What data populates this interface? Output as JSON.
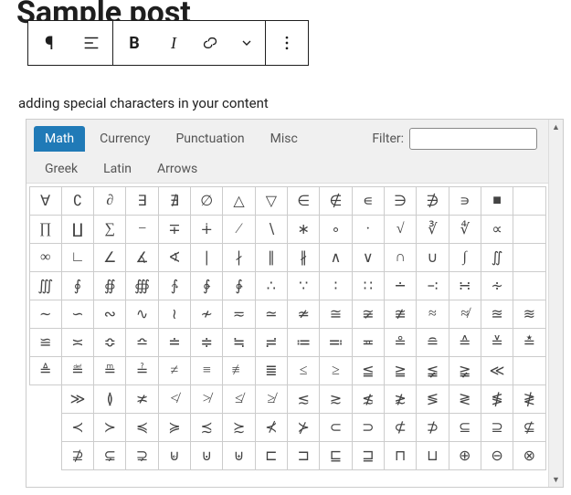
{
  "page_title": "Sample post",
  "content_line": "adding special characters in your content",
  "toolbar": {
    "pilcrow": "¶",
    "bold": "B",
    "italic": "I"
  },
  "charmap": {
    "filter_label": "Filter:",
    "tabs_row1": [
      {
        "label": "Math",
        "active": true
      },
      {
        "label": "Currency",
        "active": false
      },
      {
        "label": "Punctuation",
        "active": false
      },
      {
        "label": "Misc",
        "active": false
      }
    ],
    "tabs_row2": [
      {
        "label": "Greek",
        "active": false
      },
      {
        "label": "Latin",
        "active": false
      },
      {
        "label": "Arrows",
        "active": false
      }
    ],
    "grid": [
      [
        "∀",
        "∁",
        "∂",
        "∃",
        "∄",
        "∅",
        "△",
        "▽",
        "∈",
        "∉",
        "∊",
        "∋",
        "∌",
        "∍",
        "■",
        ""
      ],
      [
        "∏",
        "∐",
        "∑",
        "−",
        "∓",
        "∔",
        "∕",
        "∖",
        "∗",
        "∘",
        "∙",
        "√",
        "∛",
        "∜",
        "∝",
        ""
      ],
      [
        "∞",
        "∟",
        "∠",
        "∡",
        "∢",
        "∣",
        "∤",
        "∥",
        "∦",
        "∧",
        "∨",
        "∩",
        "∪",
        "∫",
        "∬",
        ""
      ],
      [
        "∭",
        "∮",
        "∯",
        "∰",
        "∱",
        "∲",
        "∳",
        "∴",
        "∵",
        "∶",
        "∷",
        "∸",
        "∹",
        "∺",
        "∻",
        ""
      ],
      [
        "∼",
        "∽",
        "∾",
        "∿",
        "≀",
        "≁",
        "≂",
        "≃",
        "≄",
        "≅",
        "≆",
        "≇",
        "≈",
        "≉",
        "≊",
        "≋",
        "≌"
      ],
      [
        "≍",
        "≎",
        "≏",
        "≐",
        "≑",
        "≒",
        "≓",
        "≔",
        "≕",
        "≖",
        "≗",
        "≘",
        "≙",
        "≚",
        "≛",
        "≜"
      ],
      [
        "≝",
        "≞",
        "≟",
        "≠",
        "≡",
        "≢",
        "≣",
        "≤",
        "≥",
        "≦",
        "≧",
        "≨",
        "≩",
        "≪",
        ""
      ],
      [
        "≫",
        "≬",
        "≭",
        "≮",
        "≯",
        "≰",
        "≱",
        "≲",
        "≳",
        "≴",
        "≵",
        "≶",
        "≷",
        "≸",
        "≹"
      ],
      [
        "≺",
        "≻",
        "≼",
        "≽",
        "≾",
        "≿",
        "⊀",
        "⊁",
        "⊂",
        "⊃",
        "⊄",
        "⊅",
        "⊆",
        "⊇",
        "⊈"
      ],
      [
        "⊉",
        "⊊",
        "⊋",
        "⊌",
        "⊍",
        "⊎",
        "⊏",
        "⊐",
        "⊑",
        "⊒",
        "⊓",
        "⊔",
        "⊕",
        "⊖",
        "⊗"
      ]
    ]
  }
}
